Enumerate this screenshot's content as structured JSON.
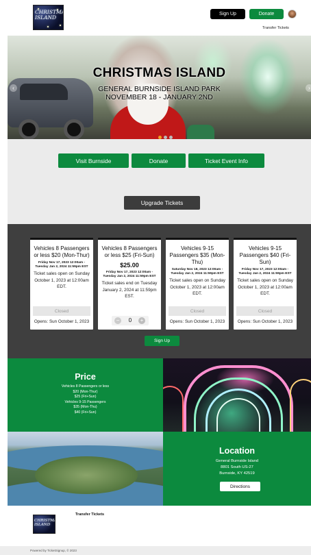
{
  "header": {
    "logo_text": "CHRISTMAS ISLAND",
    "signup_label": "Sign Up",
    "donate_label": "Donate",
    "transfer_label": "Transfer Tickets"
  },
  "hero": {
    "title": "CHRISTMAS ISLAND",
    "subtitle1": "GENERAL BURNSIDE ISLAND PARK",
    "subtitle2": "NOVEMBER 18 - JANUARY 2ND",
    "prev_glyph": "‹",
    "next_glyph": "›",
    "slide_count": 3,
    "active_slide": 1
  },
  "actions": {
    "visit_label": "Visit Burnside",
    "donate_label": "Donate",
    "event_info_label": "Ticket Event Info",
    "upgrade_label": "Upgrade Tickets"
  },
  "tickets": [
    {
      "title": "Vehicles 8 Passengers or less $20 (Mon-Thur)",
      "dates": "Friday Nov 17, 2023 12:00am - Tuesday Jan 2, 2024 11:59pm EST",
      "note": "Ticket sales open on Sunday October 1, 2023 at 12:00am EDT.",
      "status": "Closed",
      "opens": "Opens: Sun October 1, 2023"
    },
    {
      "title": "Vehicles 8 Passengers or less $25 (Fri-Sun)",
      "price": "$25.00",
      "dates": "Friday Nov 17, 2023 12:00am - Tuesday Jan 2, 2024 11:59pm EST",
      "note": "Ticket sales end on Tuesday January 2, 2024 at 11:59pm EST.",
      "quantity": "0",
      "minus": "−",
      "plus": "+"
    },
    {
      "title": "Vehicles 9-15 Passengers $35 (Mon-Thu)",
      "dates": "Saturday Nov 18, 2023 12:00am - Tuesday Jan 2, 2024 11:59pm EST",
      "note": "Ticket sales open on Sunday October 1, 2023 at 12:00am EDT.",
      "status": "Closed",
      "opens": "Opens: Sun October 1, 2023"
    },
    {
      "title": "Vehicles 9-15 Passengers $40 (Fri-Sun)",
      "dates": "Friday Nov 17, 2023 12:00am - Tuesday Jan 2, 2024 11:59pm EST",
      "note": "Ticket sales open on Sunday October 1, 2023 at 12:00am EDT.",
      "status": "Closed",
      "opens": "Opens: Sun October 1, 2023"
    }
  ],
  "signup_label": "Sign Up",
  "price_block": {
    "title": "Price",
    "lines": [
      "Vehicles 8 Passengers or less",
      "$20 (Mon-Thur)",
      "$25 (Fri+Sun)",
      "Vehicles 9-15 Passengers",
      "$35 (Mon-Thu)",
      "$40 (Fri+Sun)"
    ]
  },
  "location_block": {
    "title": "Location",
    "line1": "General Burnside Island",
    "line2": "8801 South US-27",
    "line3": "Burnside, KY 42519",
    "directions_label": "Directions"
  },
  "footer": {
    "logo_text": "CHRISTMAS ISLAND",
    "transfer_label": "Transfer Tickets",
    "powered": "Powered by TicketSignup, © 2023"
  },
  "colors": {
    "brand_green": "#0c8a3e",
    "dark_band": "#3f3f3f",
    "light_band": "#ebebeb",
    "slide_dot_active": "#f0a020"
  }
}
